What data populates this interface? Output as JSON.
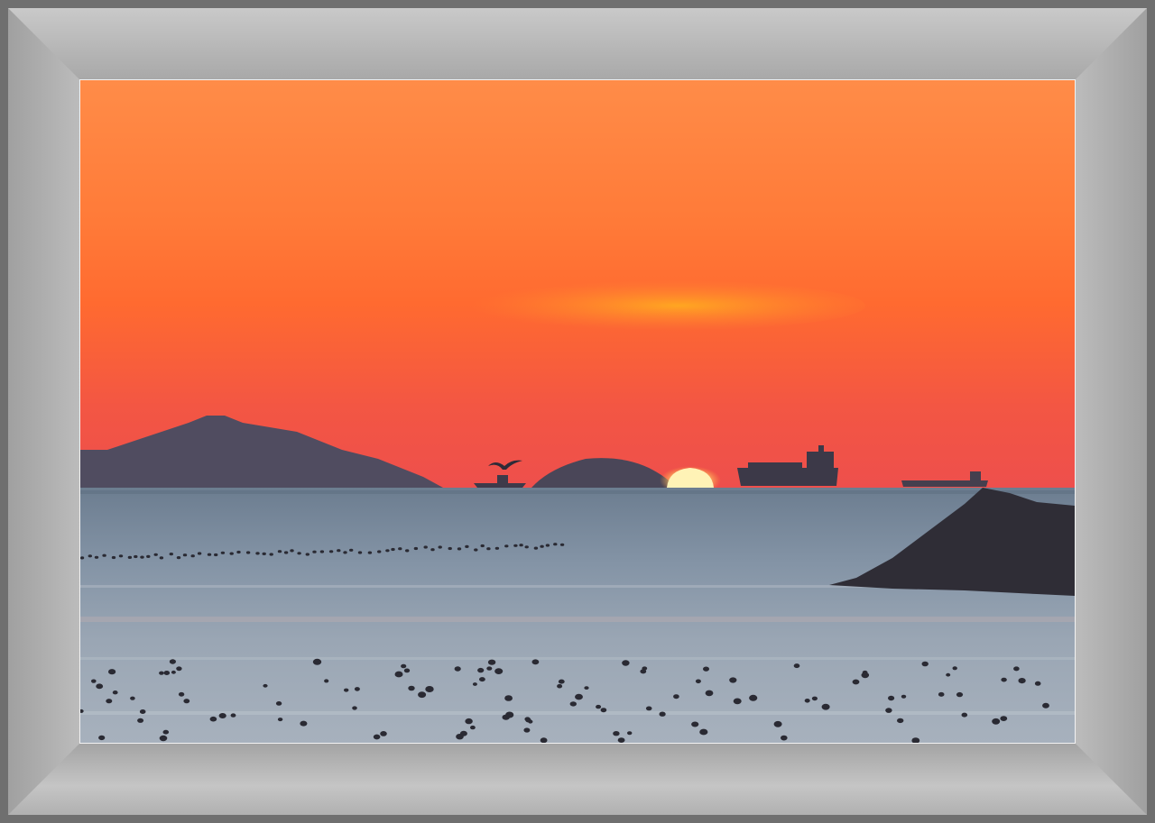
{
  "scene": {
    "subject": "sunset-over-sea",
    "colors": {
      "frame_outer": "#6f6f6f",
      "mat": "#bdbdbd",
      "sky_top": "#ff8f45",
      "sky_mid": "#ff6a2e",
      "sky_horizon": "#f2504a",
      "sun": "#fff2b0",
      "water": "#8a98a8",
      "silhouette": "#3f3f4e"
    }
  }
}
